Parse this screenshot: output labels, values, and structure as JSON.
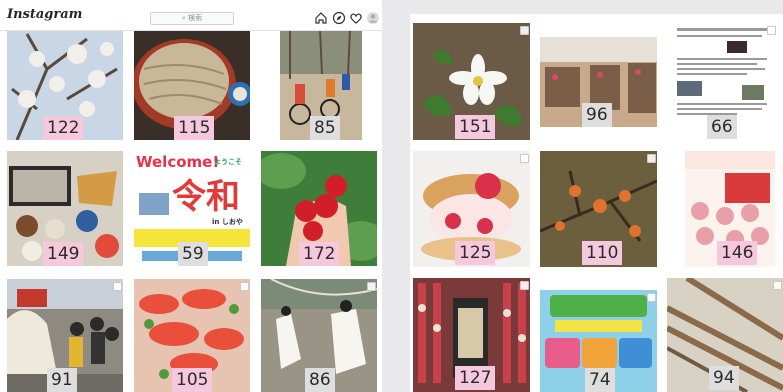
{
  "left": {
    "app_name": "Instagram",
    "search_placeholder": "検索",
    "icons": [
      "home-icon",
      "compass-icon",
      "heart-icon",
      "profile-icon"
    ],
    "tiles": [
      {
        "name": "plum-blossom",
        "count": "122",
        "badge": "pink"
      },
      {
        "name": "soba-noodles",
        "count": "115",
        "badge": "pink"
      },
      {
        "name": "mtb-race",
        "count": "85",
        "badge": "gray"
      },
      {
        "name": "set-meal",
        "count": "149",
        "badge": "pink"
      },
      {
        "name": "welcome-reiwa-poster",
        "count": "59",
        "badge": "gray"
      },
      {
        "name": "strawberries-hand",
        "count": "172",
        "badge": "pink"
      },
      {
        "name": "festival-crowd",
        "count": "91",
        "badge": "gray"
      },
      {
        "name": "sashimi-platter",
        "count": "105",
        "badge": "pink"
      },
      {
        "name": "white-robed-ritual",
        "count": "86",
        "badge": "gray"
      }
    ],
    "poster": {
      "welcome": "Welcome!",
      "script": "ようこそ",
      "reiwa": "令和",
      "in": "in しおや"
    }
  },
  "right": {
    "tiles": [
      {
        "name": "white-flower",
        "count": "151",
        "badge": "pink"
      },
      {
        "name": "exhibition-hall",
        "count": "96",
        "badge": "gray"
      },
      {
        "name": "document-page",
        "count": "66",
        "badge": "gray"
      },
      {
        "name": "strawberry-dessert",
        "count": "125",
        "badge": "pink"
      },
      {
        "name": "witch-hazel",
        "count": "110",
        "badge": "pink"
      },
      {
        "name": "sweets-flyer",
        "count": "146",
        "badge": "pink"
      },
      {
        "name": "hina-dolls",
        "count": "127",
        "badge": "pink"
      },
      {
        "name": "event-poster",
        "count": "74",
        "badge": "gray"
      },
      {
        "name": "bamboo-detail",
        "count": "94",
        "badge": "gray"
      }
    ]
  },
  "colors": {
    "pink_badge": "#f6c8dd",
    "gray_badge": "#dedede",
    "accent_red": "#e03a3a"
  }
}
